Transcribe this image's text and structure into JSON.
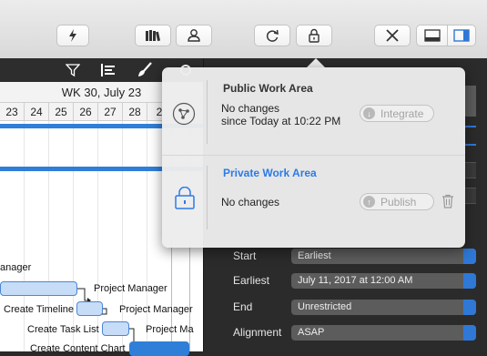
{
  "toolbar": {
    "buttons": [
      {
        "name": "quick-entry-button",
        "icon": "lightning-icon"
      },
      {
        "name": "library-button",
        "icon": "books-icon"
      },
      {
        "name": "resources-button",
        "icon": "person-icon"
      },
      {
        "name": "refresh-button",
        "icon": "refresh-icon"
      },
      {
        "name": "lock-button",
        "icon": "lock-icon"
      },
      {
        "name": "tools-button",
        "icon": "tools-icon"
      },
      {
        "name": "bottom-pane-button",
        "icon": "bottom-pane-icon"
      },
      {
        "name": "sidebar-button",
        "icon": "right-pane-icon"
      }
    ]
  },
  "gantt": {
    "week_label": "WK 30, July 23",
    "days": [
      "23",
      "24",
      "25",
      "26",
      "27",
      "28",
      "2"
    ],
    "labels": {
      "manager_cut": "anager",
      "project_manager_1": "Project Manager",
      "create_timeline": "Create Timeline",
      "project_manager_2": "Project Manager",
      "create_task_list": "Create Task List",
      "project_manager_3": "Project Ma",
      "create_content_chart": "Create Content Chart"
    }
  },
  "popover": {
    "public": {
      "title": "Public Work Area",
      "status_line1": "No changes",
      "status_line2": "since Today at 10:22 PM",
      "action": "Integrate"
    },
    "private": {
      "title": "Private Work Area",
      "status": "No changes",
      "action": "Publish"
    }
  },
  "inspector": {
    "rows": [
      {
        "label": "Start",
        "value": "Earliest"
      },
      {
        "label": "Earliest",
        "value": "July 11, 2017 at 12:00 AM"
      },
      {
        "label": "End",
        "value": "Unrestricted"
      },
      {
        "label": "Alignment",
        "value": "ASAP"
      }
    ]
  },
  "colors": {
    "accent": "#2f7fd8",
    "private_title": "#2c7be5"
  }
}
